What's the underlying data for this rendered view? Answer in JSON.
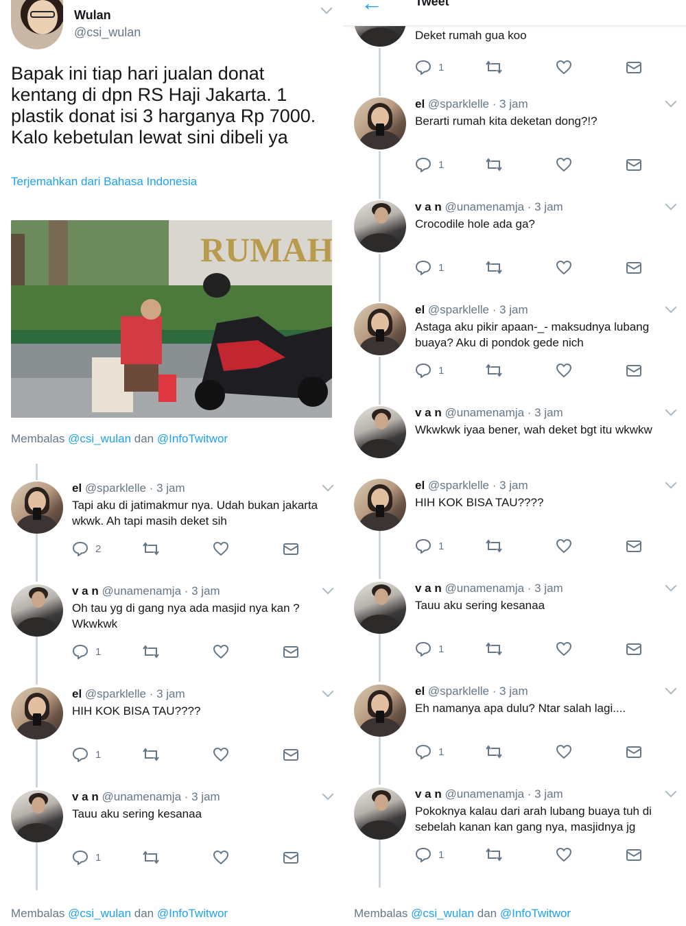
{
  "main_tweet": {
    "name": "Wulan",
    "handle": "@csi_wulan",
    "text": "Bapak ini tiap hari jualan donat kentang di dpn RS Haji Jakarta. 1 plastik donat isi 3 harganya Rp 7000. Kalo kebetulan lewat sini dibeli ya",
    "translate": "Terjemahkan dari Bahasa Indonesia",
    "photo_sign": "RUMAH"
  },
  "reply_to": {
    "prefix": "Membalas ",
    "mention1": "@csi_wulan",
    "joiner": " dan ",
    "mention2": "@InfoTwitwor"
  },
  "header": {
    "title": "Tweet"
  },
  "panel_tr": {
    "first_text": "Deket rumah gua koo",
    "first_reply_count": "1",
    "tweets": [
      {
        "name": "el",
        "handle": "@sparklelle · 3 jam",
        "text": "Berarti rumah kita deketan dong?!?",
        "reply_count": "1"
      },
      {
        "name": "v a n",
        "handle": "@unamenamja · 3 jam",
        "text": "Crocodile hole ada ga?",
        "reply_count": "1"
      },
      {
        "name": "el",
        "handle": "@sparklelle · 3 jam",
        "text": "Astaga aku pikir apaan-_- maksudnya lubang buaya? Aku di pondok gede nich",
        "reply_count": "1"
      },
      {
        "name": "v a n",
        "handle": "@unamenamja · 3 jam",
        "text": "Wkwkwk iyaa bener, wah deket bgt itu wkwkw",
        "reply_count": ""
      }
    ]
  },
  "panel_bl": {
    "tweets": [
      {
        "name": "el",
        "handle": "@sparklelle · 3 jam",
        "text": "Tapi aku di jatimakmur nya. Udah bukan jakarta wkwk. Ah tapi masih deket sih",
        "reply_count": "2"
      },
      {
        "name": "v a n",
        "handle": "@unamenamja · 3 jam",
        "text": "Oh tau yg di gang nya ada masjid nya kan ? Wkwkwk",
        "reply_count": "1"
      },
      {
        "name": "el",
        "handle": "@sparklelle · 3 jam",
        "text": "HIH KOK BISA TAU????",
        "reply_count": "1"
      },
      {
        "name": "v a n",
        "handle": "@unamenamja · 3 jam",
        "text": "Tauu aku sering kesanaa",
        "reply_count": "1"
      }
    ]
  },
  "panel_br": {
    "tweets": [
      {
        "name": "el",
        "handle": "@sparklelle · 3 jam",
        "text": "HIH KOK BISA TAU????",
        "reply_count": "1"
      },
      {
        "name": "v a n",
        "handle": "@unamenamja · 3 jam",
        "text": "Tauu aku sering kesanaa",
        "reply_count": "1"
      },
      {
        "name": "el",
        "handle": "@sparklelle · 3 jam",
        "text": "Eh namanya apa dulu? Ntar salah lagi....",
        "reply_count": "1"
      },
      {
        "name": "v a n",
        "handle": "@unamenamja · 3 jam",
        "text": "Pokoknya kalau dari arah lubang buaya tuh di sebelah kanan kan gang nya, masjidnya jg",
        "reply_count": "1"
      }
    ]
  },
  "colors": {
    "link": "#1da1f2",
    "muted": "#657786",
    "text": "#14171a",
    "border": "#e6ecf0"
  }
}
